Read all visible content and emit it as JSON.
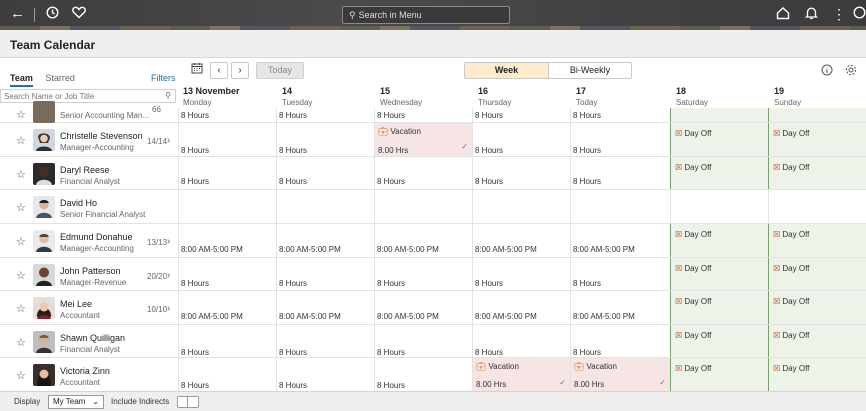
{
  "topbar": {
    "back_icon": "arrow-left-icon",
    "recent_icon": "clock-icon",
    "favorites_icon": "heart-icon",
    "search_placeholder": "Search in Menu",
    "home_icon": "home-icon",
    "notifications_icon": "bell-icon",
    "actions_icon": "kebab-icon"
  },
  "page": {
    "title": "Team Calendar"
  },
  "left_panel": {
    "tabs": [
      {
        "label": "Team",
        "active": true
      },
      {
        "label": "Starred",
        "active": false
      }
    ],
    "filters_label": "Filters",
    "search_placeholder": "Search Name or Job Title"
  },
  "toolbar": {
    "today_label": "Today",
    "views": [
      {
        "label": "Week",
        "selected": true
      },
      {
        "label": "Bi-Weekly",
        "selected": false
      }
    ]
  },
  "days": [
    {
      "date": "13 November",
      "weekday": "Monday"
    },
    {
      "date": "14",
      "weekday": "Tuesday"
    },
    {
      "date": "15",
      "weekday": "Wednesday"
    },
    {
      "date": "16",
      "weekday": "Thursday"
    },
    {
      "date": "17",
      "weekday": "Today"
    },
    {
      "date": "18",
      "weekday": "Saturday"
    },
    {
      "date": "19",
      "weekday": "Sunday"
    }
  ],
  "rows": [
    {
      "name": "",
      "role": "Senior Accounting Man...",
      "count": "66",
      "days": [
        "8 Hours",
        "8 Hours",
        "8 Hours",
        "8 Hours",
        "8 Hours",
        "",
        ""
      ]
    },
    {
      "name": "Christelle Stevenson",
      "role": "Manager-Accounting",
      "count": "14/14",
      "days": [
        "8 Hours",
        "8 Hours",
        "8.00 Hrs",
        "8 Hours",
        "8 Hours",
        "",
        ""
      ]
    },
    {
      "name": "Daryl Reese",
      "role": "Financial Analyst",
      "count": "",
      "days": [
        "8 Hours",
        "8 Hours",
        "8 Hours",
        "8 Hours",
        "8 Hours",
        "",
        ""
      ]
    },
    {
      "name": "David Ho",
      "role": "Senior Financial Analyst",
      "count": "",
      "days": [
        "",
        "",
        "",
        "",
        "",
        "",
        ""
      ]
    },
    {
      "name": "Edmund Donahue",
      "role": "Manager-Accounting",
      "count": "13/13",
      "days": [
        "8:00 AM-5:00 PM",
        "8:00 AM-5:00 PM",
        "8:00 AM-5:00 PM",
        "8:00 AM-5:00 PM",
        "8:00 AM-5:00 PM",
        "",
        ""
      ]
    },
    {
      "name": "John Patterson",
      "role": "Manager-Revenue",
      "count": "20/20",
      "days": [
        "8 Hours",
        "8 Hours",
        "8 Hours",
        "8 Hours",
        "8 Hours",
        "",
        ""
      ]
    },
    {
      "name": "Mei Lee",
      "role": "Accountant",
      "count": "10/10",
      "days": [
        "8:00 AM-5:00 PM",
        "8:00 AM-5:00 PM",
        "8:00 AM-5:00 PM",
        "8:00 AM-5:00 PM",
        "8:00 AM-5:00 PM",
        "",
        ""
      ]
    },
    {
      "name": "Shawn Quilligan",
      "role": "Financial Analyst",
      "count": "",
      "days": [
        "8 Hours",
        "8 Hours",
        "8 Hours",
        "8 Hours",
        "8 Hours",
        "",
        ""
      ]
    },
    {
      "name": "Victoria Zinn",
      "role": "Accountant",
      "count": "",
      "days": [
        "8 Hours",
        "8 Hours",
        "8 Hours",
        "8.00 Hrs",
        "8.00 Hrs",
        "",
        ""
      ]
    }
  ],
  "labels": {
    "vacation": "Vacation",
    "day_off": "Day Off"
  },
  "footer": {
    "display_label": "Display",
    "display_value": "My Team",
    "include_indirects_label": "Include Indirects"
  },
  "colors": {
    "accent": "#2b6aa6",
    "vacation_bg": "#f7e4e4",
    "dayoff_bg": "#eef3ea",
    "week_selected_bg": "#fdebc9"
  }
}
